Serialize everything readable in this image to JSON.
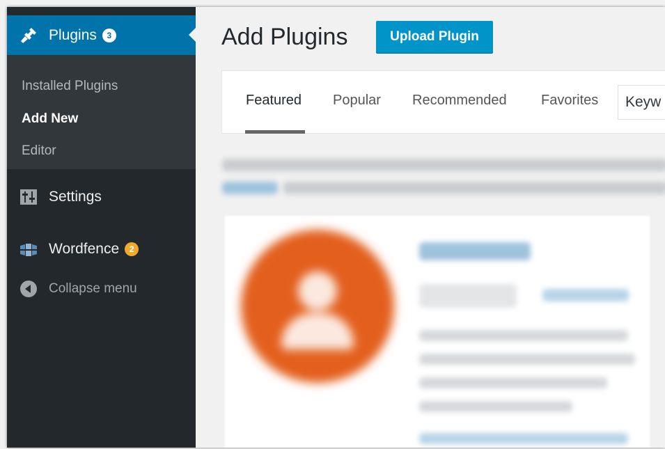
{
  "sidebar": {
    "plugins": {
      "label": "Plugins",
      "badge": "3",
      "icon": "plugin-icon"
    },
    "submenu": [
      {
        "label": "Installed Plugins"
      },
      {
        "label": "Add New"
      },
      {
        "label": "Editor"
      }
    ],
    "settings": {
      "label": "Settings",
      "icon": "settings-icon"
    },
    "wordfence": {
      "label": "Wordfence",
      "badge": "2",
      "icon": "wordfence-icon"
    },
    "collapse": {
      "label": "Collapse menu",
      "icon": "collapse-icon"
    }
  },
  "main": {
    "title": "Add Plugins",
    "upload_label": "Upload Plugin",
    "tabs": [
      {
        "label": "Featured"
      },
      {
        "label": "Popular"
      },
      {
        "label": "Recommended"
      },
      {
        "label": "Favorites"
      }
    ],
    "search": {
      "value": "Keyw"
    }
  },
  "colors": {
    "sidebar_bg": "#23282d",
    "submenu_bg": "#32373c",
    "accent": "#0073aa",
    "button": "#0094c9",
    "badge_orange": "#f0a92b",
    "plugin_icon": "#e35f1d"
  }
}
